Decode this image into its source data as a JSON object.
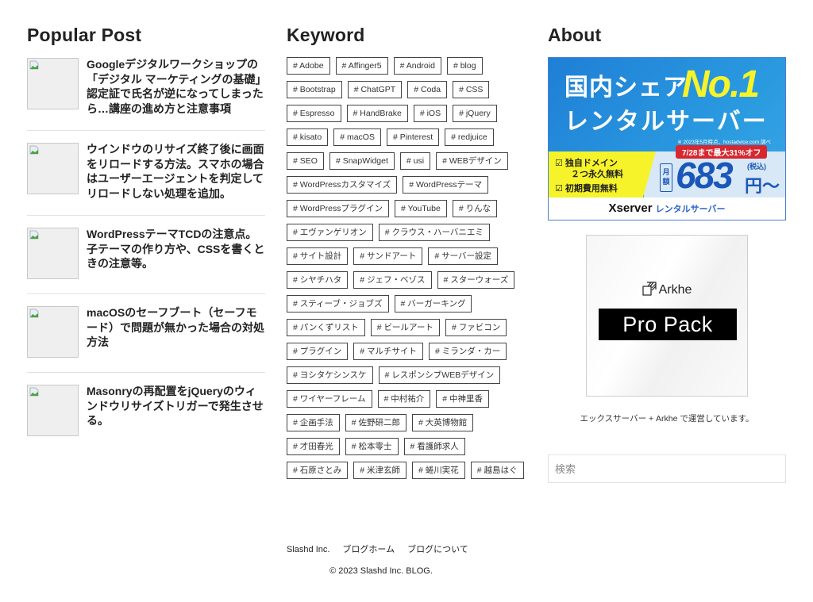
{
  "popular": {
    "title": "Popular Post",
    "posts": [
      {
        "title": "Googleデジタルワークショップの「デジタル マーケティングの基礎」認定証で氏名が逆になってしまったら…講座の進め方と注意事項"
      },
      {
        "title": "ウインドウのリサイズ終了後に画面をリロードする方法。スマホの場合はユーザーエージェントを判定してリロードしない処理を追加。"
      },
      {
        "title": "WordPressテーマTCDの注意点。子テーマの作り方や、CSSを書くときの注意等。"
      },
      {
        "title": "macOSのセーフブート（セーフモード）で問題が無かった場合の対処方法"
      },
      {
        "title": "Masonryの再配置をjQueryのウィンドウリサイズトリガーで発生させる。"
      }
    ]
  },
  "keyword": {
    "title": "Keyword",
    "tags": [
      "# Adobe",
      "# Affinger5",
      "# Android",
      "# blog",
      "# Bootstrap",
      "# ChatGPT",
      "# Coda",
      "# CSS",
      "# Espresso",
      "# HandBrake",
      "# iOS",
      "# jQuery",
      "# kisato",
      "# macOS",
      "# Pinterest",
      "# redjuice",
      "# SEO",
      "# SnapWidget",
      "# usi",
      "# WEBデザイン",
      "# WordPressカスタマイズ",
      "# WordPressテーマ",
      "# WordPressプラグイン",
      "# YouTube",
      "# りんな",
      "# エヴァンゲリオン",
      "# クラウス・ハーバニエミ",
      "# サイト設計",
      "# サンドアート",
      "# サーバー設定",
      "# シヤチハタ",
      "# ジェフ・ベゾス",
      "# スターウォーズ",
      "# スティーブ・ジョブズ",
      "# バーガーキング",
      "# パンくずリスト",
      "# ビールアート",
      "# ファビコン",
      "# プラグイン",
      "# マルチサイト",
      "# ミランダ・カー",
      "# ヨシタケシンスケ",
      "# レスポンシブWEBデザイン",
      "# ワイヤーフレーム",
      "# 中村祐介",
      "# 中神里香",
      "# 企画手法",
      "# 佐野研二郎",
      "# 大英博物館",
      "# 才田春光",
      "# 松本零士",
      "# 看護師求人",
      "# 石原さとみ",
      "# 米津玄師",
      "# 蜷川実花",
      "# 越島はぐ"
    ]
  },
  "about": {
    "title": "About",
    "xserver": {
      "line1": "国内シェア",
      "no1": "No.1",
      "line2": "レンタルサーバー",
      "note": "※ 2023年5月時点、hostadvice.com 調べ",
      "feature1a": "☑ 独自ドメイン",
      "feature1b": "２つ永久無料",
      "feature2": "☑ 初期費用無料",
      "campaign": "7/28まで最大31%オフ",
      "month_label": "月額",
      "price": "683",
      "tax": "(税込)",
      "yen": "円〜",
      "brand": "Xserver",
      "brand_sub": "レンタルサーバー"
    },
    "arkhe": {
      "logo_text": "Arkhe",
      "product": "Pro Pack"
    },
    "caption": "エックスサーバー + Arkhe で運営しています。",
    "search_placeholder": "検索"
  },
  "footer": {
    "links": [
      "Slashd Inc.",
      "ブログホーム",
      "ブログについて"
    ],
    "copyright": "© 2023 Slashd Inc. BLOG."
  },
  "colors": {
    "text": "#222222",
    "tag_border": "#444444",
    "xserver_blue": "#1b57b8",
    "xserver_yellow": "#f6f32a",
    "campaign_red": "#d7282f"
  }
}
